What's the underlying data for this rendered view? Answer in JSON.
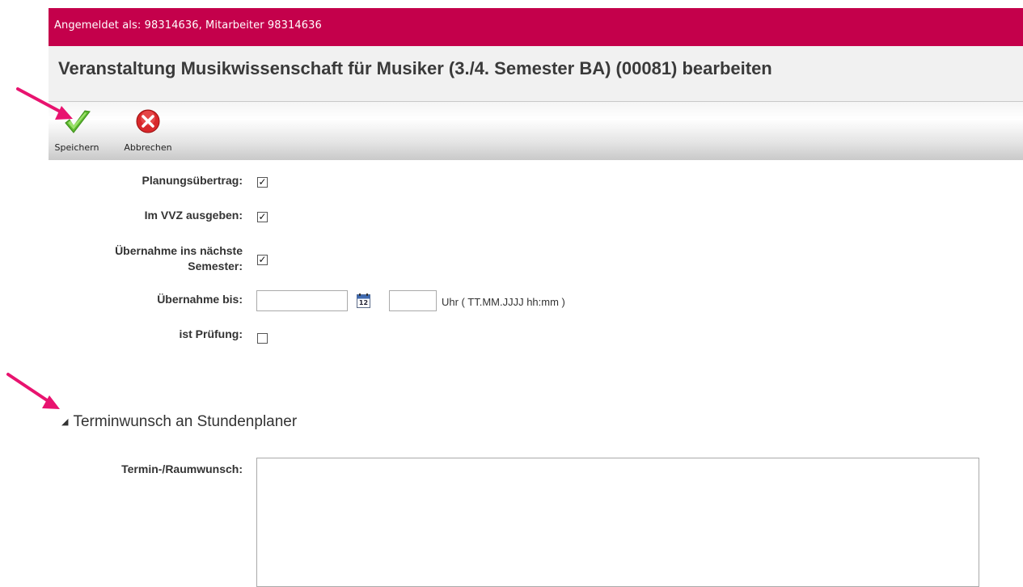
{
  "header": {
    "login_text": "Angemeldet als: 98314636, Mitarbeiter 98314636",
    "page_title": "Veranstaltung Musikwissenschaft für Musiker (3./4. Semester BA) (00081) bearbeiten"
  },
  "toolbar": {
    "save_label": "Speichern",
    "cancel_label": "Abbrechen"
  },
  "form": {
    "planungsuebertrag": {
      "label": "Planungsübertrag:",
      "checked": true,
      "mark": "✓"
    },
    "im_vvz": {
      "label": "Im VVZ ausgeben:",
      "checked": true,
      "mark": "✓"
    },
    "uebernahme_semester": {
      "label_line1": "Übernahme ins nächste",
      "label_line2": "Semester:",
      "checked": true,
      "mark": "✓"
    },
    "uebernahme_bis": {
      "label": "Übernahme bis:",
      "date_value": "",
      "time_value": "",
      "hint": "Uhr ( TT.MM.JJJJ hh:mm )",
      "calendar_day": "12"
    },
    "ist_pruefung": {
      "label": "ist Prüfung:",
      "checked": false,
      "mark": ""
    }
  },
  "section": {
    "title": "Terminwunsch an Stundenplaner",
    "collapse_glyph": "◢",
    "wish_label": "Termin-/Raumwunsch:",
    "wish_value": ""
  },
  "colors": {
    "brand": "#c4004b",
    "annotation_arrow": "#e8136f"
  }
}
